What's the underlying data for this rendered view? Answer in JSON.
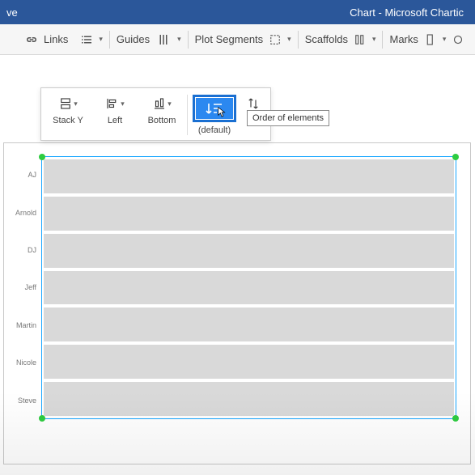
{
  "titlebar": {
    "left_fragment": "ve",
    "app_title": "Chart - Microsoft Chartic"
  },
  "ribbon": {
    "links": "Links",
    "guides": "Guides",
    "plot_segments": "Plot Segments",
    "scaffolds": "Scaffolds",
    "marks": "Marks"
  },
  "floating_toolbar": {
    "items": [
      {
        "id": "stack-y",
        "label": "Stack Y"
      },
      {
        "id": "left",
        "label": "Left"
      },
      {
        "id": "bottom",
        "label": "Bottom"
      },
      {
        "id": "default-sort",
        "label": "(default)"
      },
      {
        "id": "reverse",
        "label": ""
      }
    ],
    "tooltip": "Order of elements"
  },
  "chart_data": {
    "type": "bar",
    "categories": [
      "AJ",
      "Arnold",
      "DJ",
      "Jeff",
      "Martin",
      "Nicole",
      "Steve"
    ],
    "values": [
      100,
      100,
      100,
      100,
      100,
      100,
      100
    ],
    "title": "",
    "xlabel": "",
    "ylabel": "",
    "ylim": [
      0,
      100
    ]
  }
}
